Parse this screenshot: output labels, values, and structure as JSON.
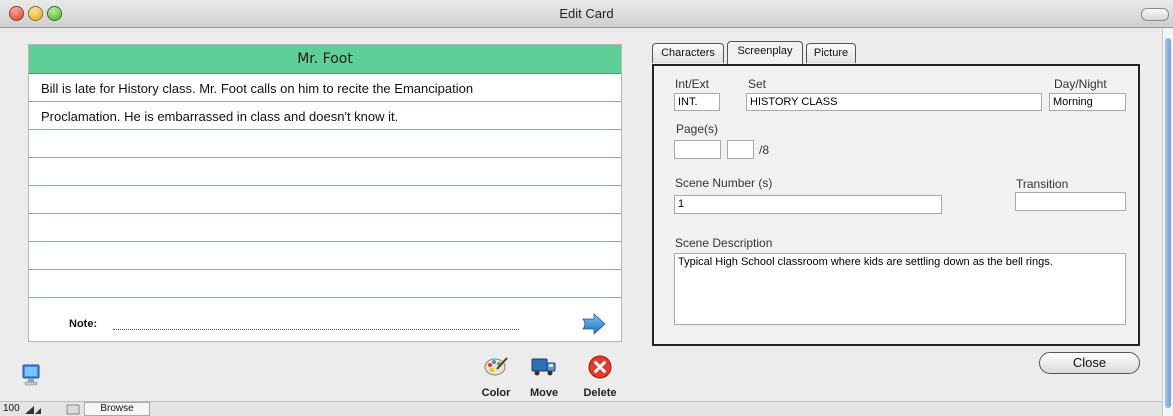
{
  "window": {
    "title": "Edit Card"
  },
  "card": {
    "header": "Mr. Foot",
    "lines": [
      "Bill is late for History class. Mr. Foot calls on him to recite the Emancipation",
      "Proclamation. He is embarrassed in class and doesn't know it.",
      "",
      "",
      "",
      "",
      "",
      "",
      ""
    ],
    "note_label": "Note:",
    "note_value": ""
  },
  "tabs": [
    {
      "label": "Characters",
      "active": false
    },
    {
      "label": "Screenplay",
      "active": true
    },
    {
      "label": "Picture",
      "active": false
    }
  ],
  "screenplay": {
    "int_ext_label": "Int/Ext",
    "int_ext_value": "INT.",
    "set_label": "Set",
    "set_value": "HISTORY CLASS",
    "day_night_label": "Day/Night",
    "day_night_value": "Morning",
    "pages_label": "Page(s)",
    "pages_whole": "",
    "pages_eighths": "",
    "pages_suffix": "/8",
    "scene_number_label": "Scene Number (s)",
    "scene_number_value": "1",
    "transition_label": "Transition",
    "transition_value": "",
    "scene_description_label": "Scene Description",
    "scene_description_value": "Typical High School classroom where kids are settling down as the bell rings."
  },
  "toolbar": {
    "color_label": "Color",
    "move_label": "Move",
    "delete_label": "Delete",
    "close_label": "Close"
  },
  "statusbar": {
    "zoom": "100",
    "mode": "Browse"
  },
  "icons": {
    "close_window": "close-window-icon",
    "minimize_window": "minimize-window-icon",
    "zoom_window": "zoom-window-icon",
    "computer": "computer-icon",
    "color": "palette-icon",
    "move": "move-truck-icon",
    "delete": "delete-x-icon",
    "next": "next-arrow-icon"
  },
  "colors": {
    "card_header": "#5ecf96",
    "card_rules": "#7aa7e0",
    "delete": "#e23a2c"
  }
}
